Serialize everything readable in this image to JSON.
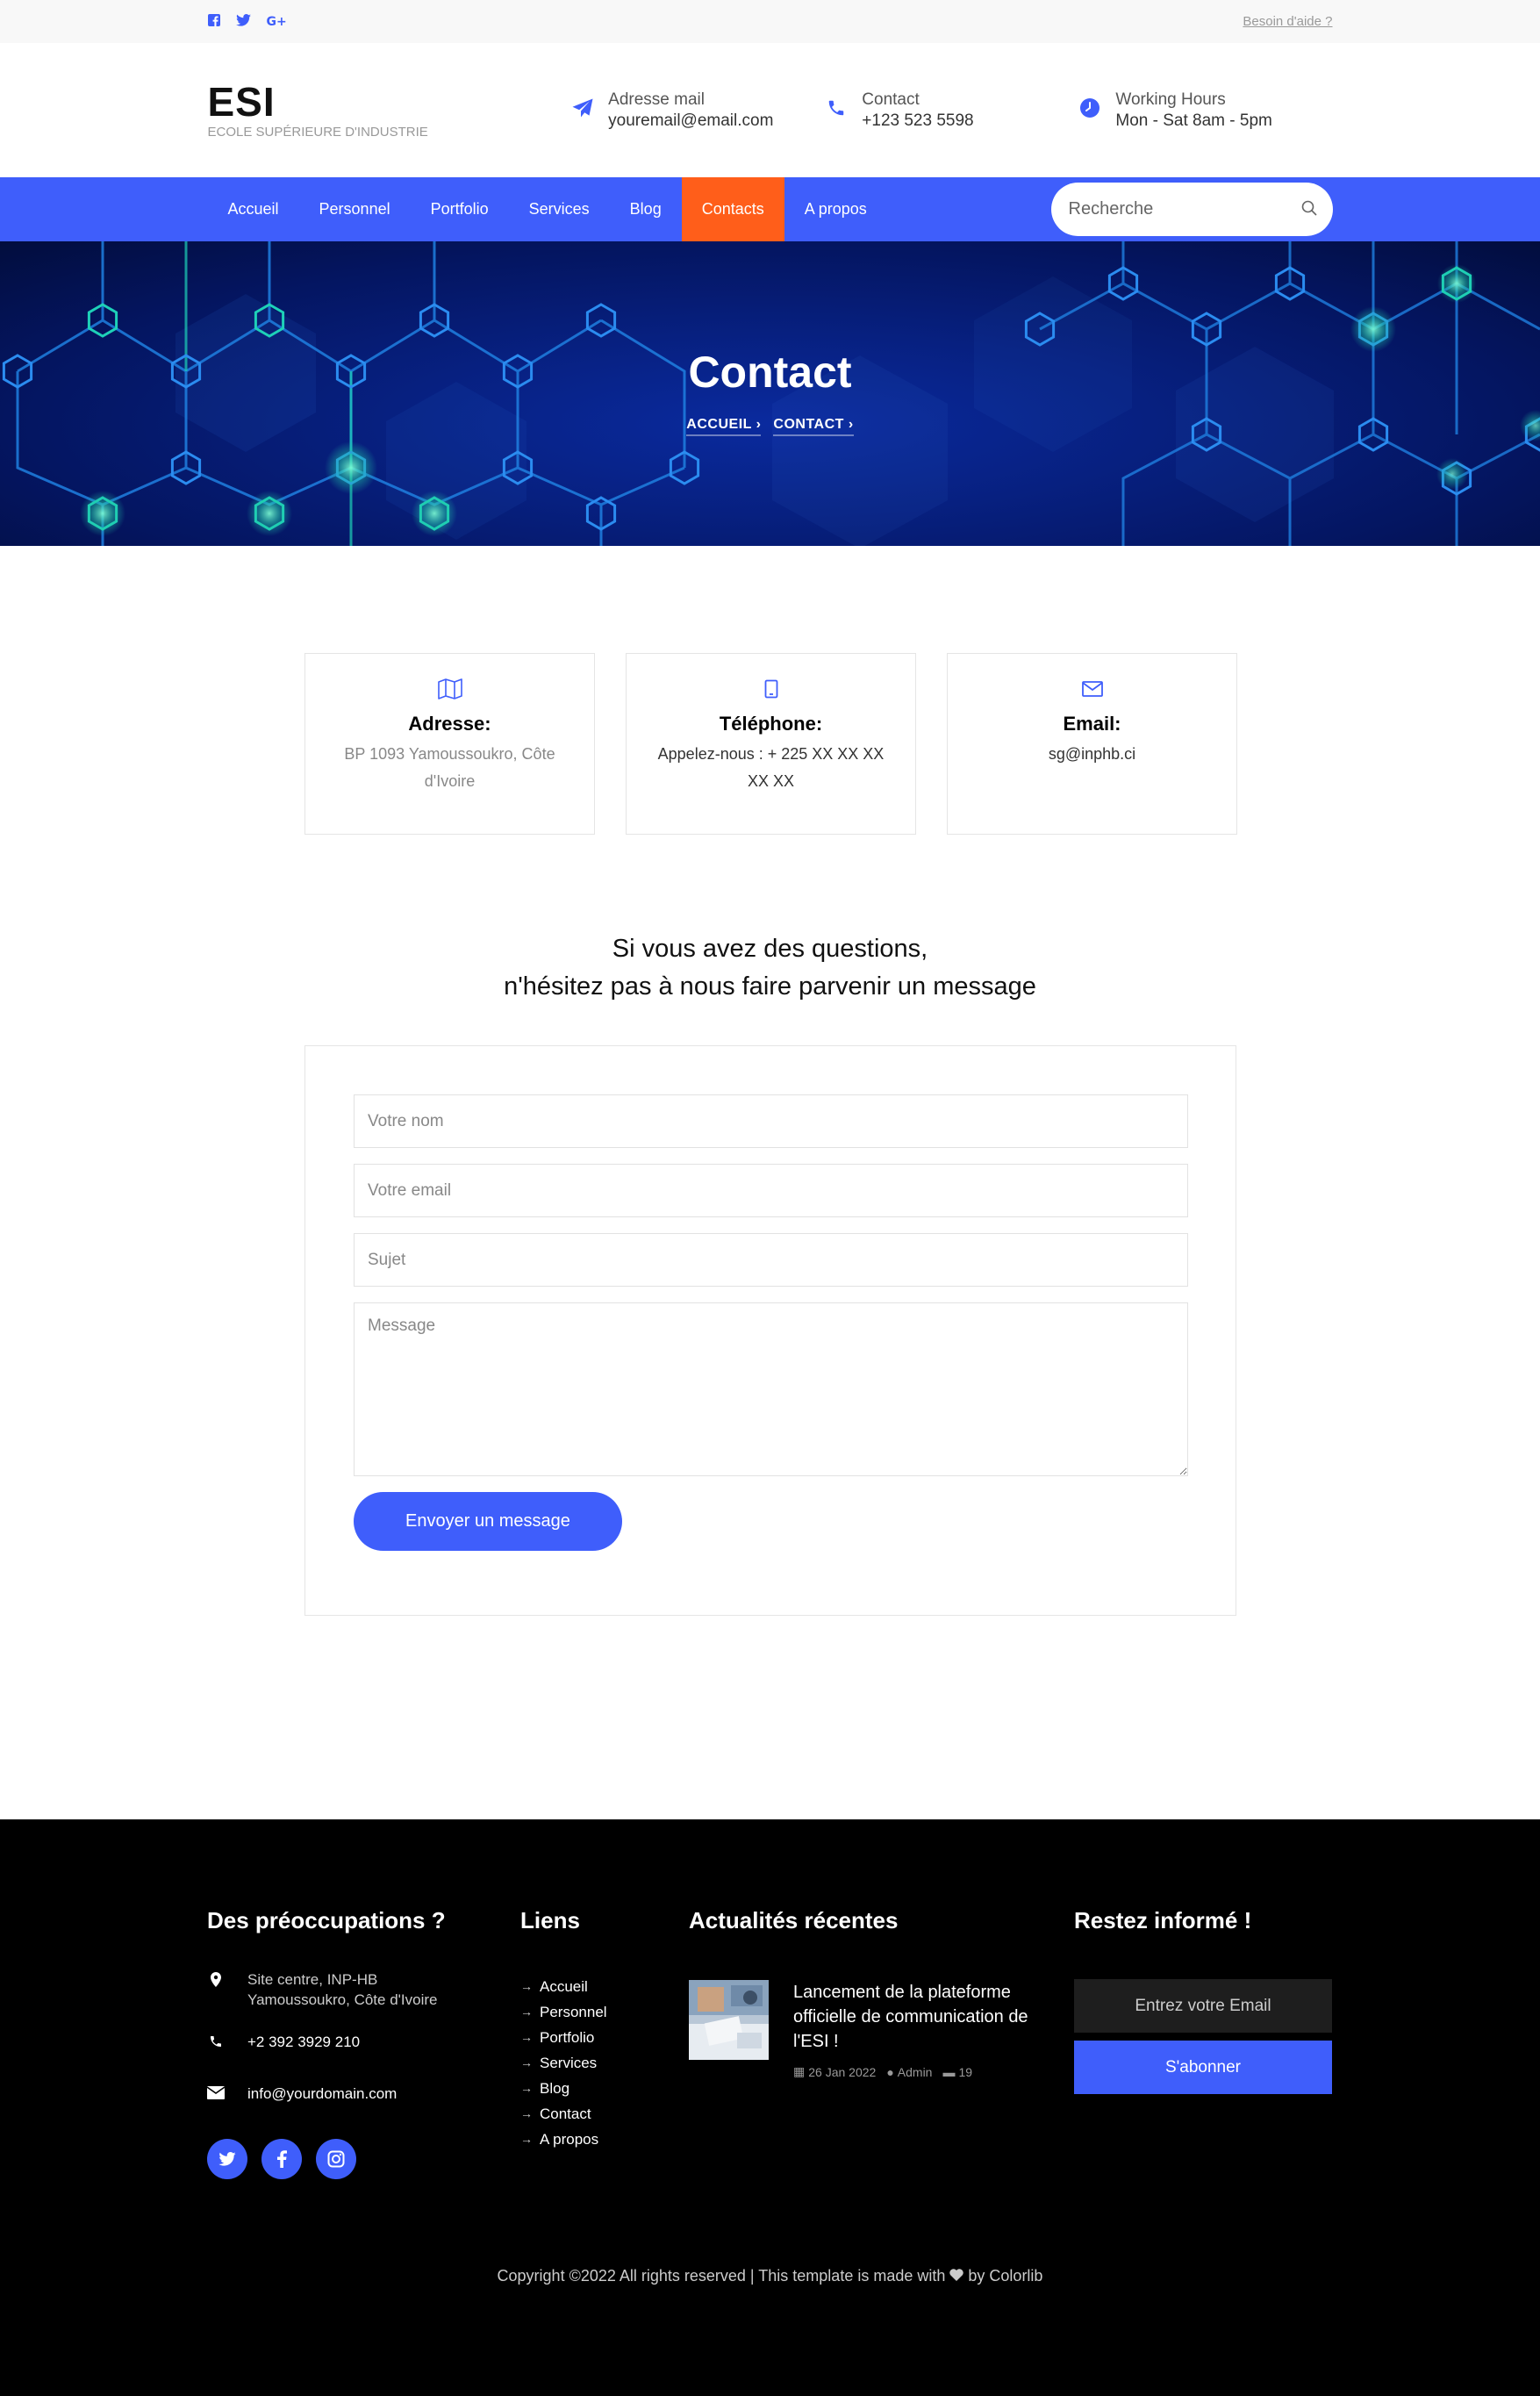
{
  "topbar": {
    "social_icons": [
      "facebook-icon",
      "twitter-icon",
      "google-plus-icon"
    ],
    "help_link": "Besoin d'aide ?"
  },
  "header": {
    "brand_name": "ESI",
    "brand_sub": "ECOLE SUPÉRIEURE D'INDUSTRIE",
    "email_label": "Adresse mail",
    "email_value": "youremail@email.com",
    "contact_label": "Contact",
    "contact_value": "+123 523 5598",
    "hours_label": "Working Hours",
    "hours_value": "Mon - Sat 8am - 5pm"
  },
  "nav": {
    "items": [
      "Accueil",
      "Personnel",
      "Portfolio",
      "Services",
      "Blog",
      "Contacts",
      "A propos"
    ],
    "active": "Contacts",
    "search_placeholder": "Recherche"
  },
  "hero": {
    "title": "Contact",
    "breadcrumb": [
      "ACCUEIL ›",
      "CONTACT ›"
    ]
  },
  "cards": [
    {
      "icon": "map-icon",
      "title": "Adresse:",
      "text": "BP 1093 Yamoussoukro, Côte d'Ivoire"
    },
    {
      "icon": "tablet-icon",
      "title": "Téléphone:",
      "text": "Appelez-nous : + 225 XX XX XX XX XX"
    },
    {
      "icon": "envelope-icon",
      "title": "Email:",
      "text": "sg@inphb.ci"
    }
  ],
  "form": {
    "heading_line1": "Si vous avez des questions,",
    "heading_line2": "n'hésitez pas à nous faire parvenir un message",
    "name_placeholder": "Votre nom",
    "email_placeholder": "Votre email",
    "subject_placeholder": "Sujet",
    "message_placeholder": "Message",
    "submit_label": "Envoyer un message"
  },
  "footer": {
    "col1_title": "Des préoccupations ?",
    "address": "Site centre, INP-HB Yamoussoukro, Côte d'Ivoire",
    "phone": "+2 392 3929 210",
    "email": "info@yourdomain.com",
    "col2_title": "Liens",
    "links": [
      "Accueil",
      "Personnel",
      "Portfolio",
      "Services",
      "Blog",
      "Contact",
      "A propos"
    ],
    "col3_title": "Actualités récentes",
    "news_title": "Lancement de la plateforme officielle de communication de l'ESI !",
    "news_date": "26 Jan 2022",
    "news_author": "Admin",
    "news_comments": "19",
    "col4_title": "Restez informé !",
    "subscribe_placeholder": "Entrez votre Email",
    "subscribe_button": "S'abonner",
    "copyright_pre": "Copyright ©2022 All rights reserved | This template is made with",
    "copyright_post": "by Colorlib"
  }
}
